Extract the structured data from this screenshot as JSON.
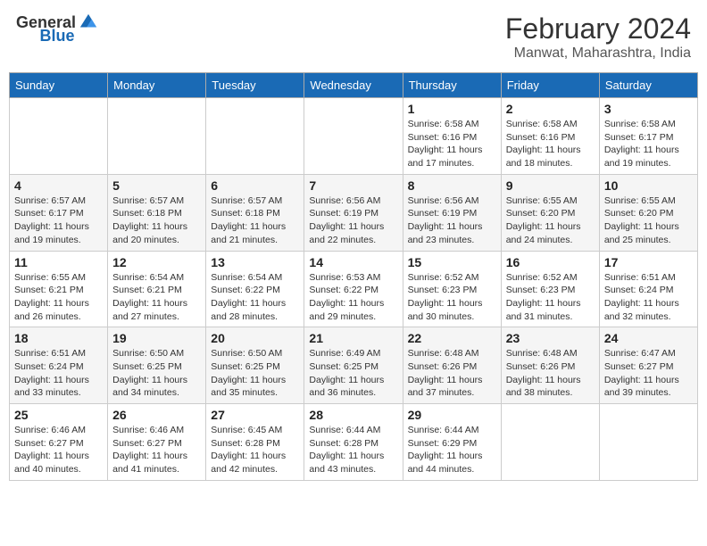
{
  "header": {
    "logo_general": "General",
    "logo_blue": "Blue",
    "month_year": "February 2024",
    "location": "Manwat, Maharashtra, India"
  },
  "days_of_week": [
    "Sunday",
    "Monday",
    "Tuesday",
    "Wednesday",
    "Thursday",
    "Friday",
    "Saturday"
  ],
  "weeks": [
    [
      {
        "day": "",
        "info": ""
      },
      {
        "day": "",
        "info": ""
      },
      {
        "day": "",
        "info": ""
      },
      {
        "day": "",
        "info": ""
      },
      {
        "day": "1",
        "info": "Sunrise: 6:58 AM\nSunset: 6:16 PM\nDaylight: 11 hours and 17 minutes."
      },
      {
        "day": "2",
        "info": "Sunrise: 6:58 AM\nSunset: 6:16 PM\nDaylight: 11 hours and 18 minutes."
      },
      {
        "day": "3",
        "info": "Sunrise: 6:58 AM\nSunset: 6:17 PM\nDaylight: 11 hours and 19 minutes."
      }
    ],
    [
      {
        "day": "4",
        "info": "Sunrise: 6:57 AM\nSunset: 6:17 PM\nDaylight: 11 hours and 19 minutes."
      },
      {
        "day": "5",
        "info": "Sunrise: 6:57 AM\nSunset: 6:18 PM\nDaylight: 11 hours and 20 minutes."
      },
      {
        "day": "6",
        "info": "Sunrise: 6:57 AM\nSunset: 6:18 PM\nDaylight: 11 hours and 21 minutes."
      },
      {
        "day": "7",
        "info": "Sunrise: 6:56 AM\nSunset: 6:19 PM\nDaylight: 11 hours and 22 minutes."
      },
      {
        "day": "8",
        "info": "Sunrise: 6:56 AM\nSunset: 6:19 PM\nDaylight: 11 hours and 23 minutes."
      },
      {
        "day": "9",
        "info": "Sunrise: 6:55 AM\nSunset: 6:20 PM\nDaylight: 11 hours and 24 minutes."
      },
      {
        "day": "10",
        "info": "Sunrise: 6:55 AM\nSunset: 6:20 PM\nDaylight: 11 hours and 25 minutes."
      }
    ],
    [
      {
        "day": "11",
        "info": "Sunrise: 6:55 AM\nSunset: 6:21 PM\nDaylight: 11 hours and 26 minutes."
      },
      {
        "day": "12",
        "info": "Sunrise: 6:54 AM\nSunset: 6:21 PM\nDaylight: 11 hours and 27 minutes."
      },
      {
        "day": "13",
        "info": "Sunrise: 6:54 AM\nSunset: 6:22 PM\nDaylight: 11 hours and 28 minutes."
      },
      {
        "day": "14",
        "info": "Sunrise: 6:53 AM\nSunset: 6:22 PM\nDaylight: 11 hours and 29 minutes."
      },
      {
        "day": "15",
        "info": "Sunrise: 6:52 AM\nSunset: 6:23 PM\nDaylight: 11 hours and 30 minutes."
      },
      {
        "day": "16",
        "info": "Sunrise: 6:52 AM\nSunset: 6:23 PM\nDaylight: 11 hours and 31 minutes."
      },
      {
        "day": "17",
        "info": "Sunrise: 6:51 AM\nSunset: 6:24 PM\nDaylight: 11 hours and 32 minutes."
      }
    ],
    [
      {
        "day": "18",
        "info": "Sunrise: 6:51 AM\nSunset: 6:24 PM\nDaylight: 11 hours and 33 minutes."
      },
      {
        "day": "19",
        "info": "Sunrise: 6:50 AM\nSunset: 6:25 PM\nDaylight: 11 hours and 34 minutes."
      },
      {
        "day": "20",
        "info": "Sunrise: 6:50 AM\nSunset: 6:25 PM\nDaylight: 11 hours and 35 minutes."
      },
      {
        "day": "21",
        "info": "Sunrise: 6:49 AM\nSunset: 6:25 PM\nDaylight: 11 hours and 36 minutes."
      },
      {
        "day": "22",
        "info": "Sunrise: 6:48 AM\nSunset: 6:26 PM\nDaylight: 11 hours and 37 minutes."
      },
      {
        "day": "23",
        "info": "Sunrise: 6:48 AM\nSunset: 6:26 PM\nDaylight: 11 hours and 38 minutes."
      },
      {
        "day": "24",
        "info": "Sunrise: 6:47 AM\nSunset: 6:27 PM\nDaylight: 11 hours and 39 minutes."
      }
    ],
    [
      {
        "day": "25",
        "info": "Sunrise: 6:46 AM\nSunset: 6:27 PM\nDaylight: 11 hours and 40 minutes."
      },
      {
        "day": "26",
        "info": "Sunrise: 6:46 AM\nSunset: 6:27 PM\nDaylight: 11 hours and 41 minutes."
      },
      {
        "day": "27",
        "info": "Sunrise: 6:45 AM\nSunset: 6:28 PM\nDaylight: 11 hours and 42 minutes."
      },
      {
        "day": "28",
        "info": "Sunrise: 6:44 AM\nSunset: 6:28 PM\nDaylight: 11 hours and 43 minutes."
      },
      {
        "day": "29",
        "info": "Sunrise: 6:44 AM\nSunset: 6:29 PM\nDaylight: 11 hours and 44 minutes."
      },
      {
        "day": "",
        "info": ""
      },
      {
        "day": "",
        "info": ""
      }
    ]
  ]
}
